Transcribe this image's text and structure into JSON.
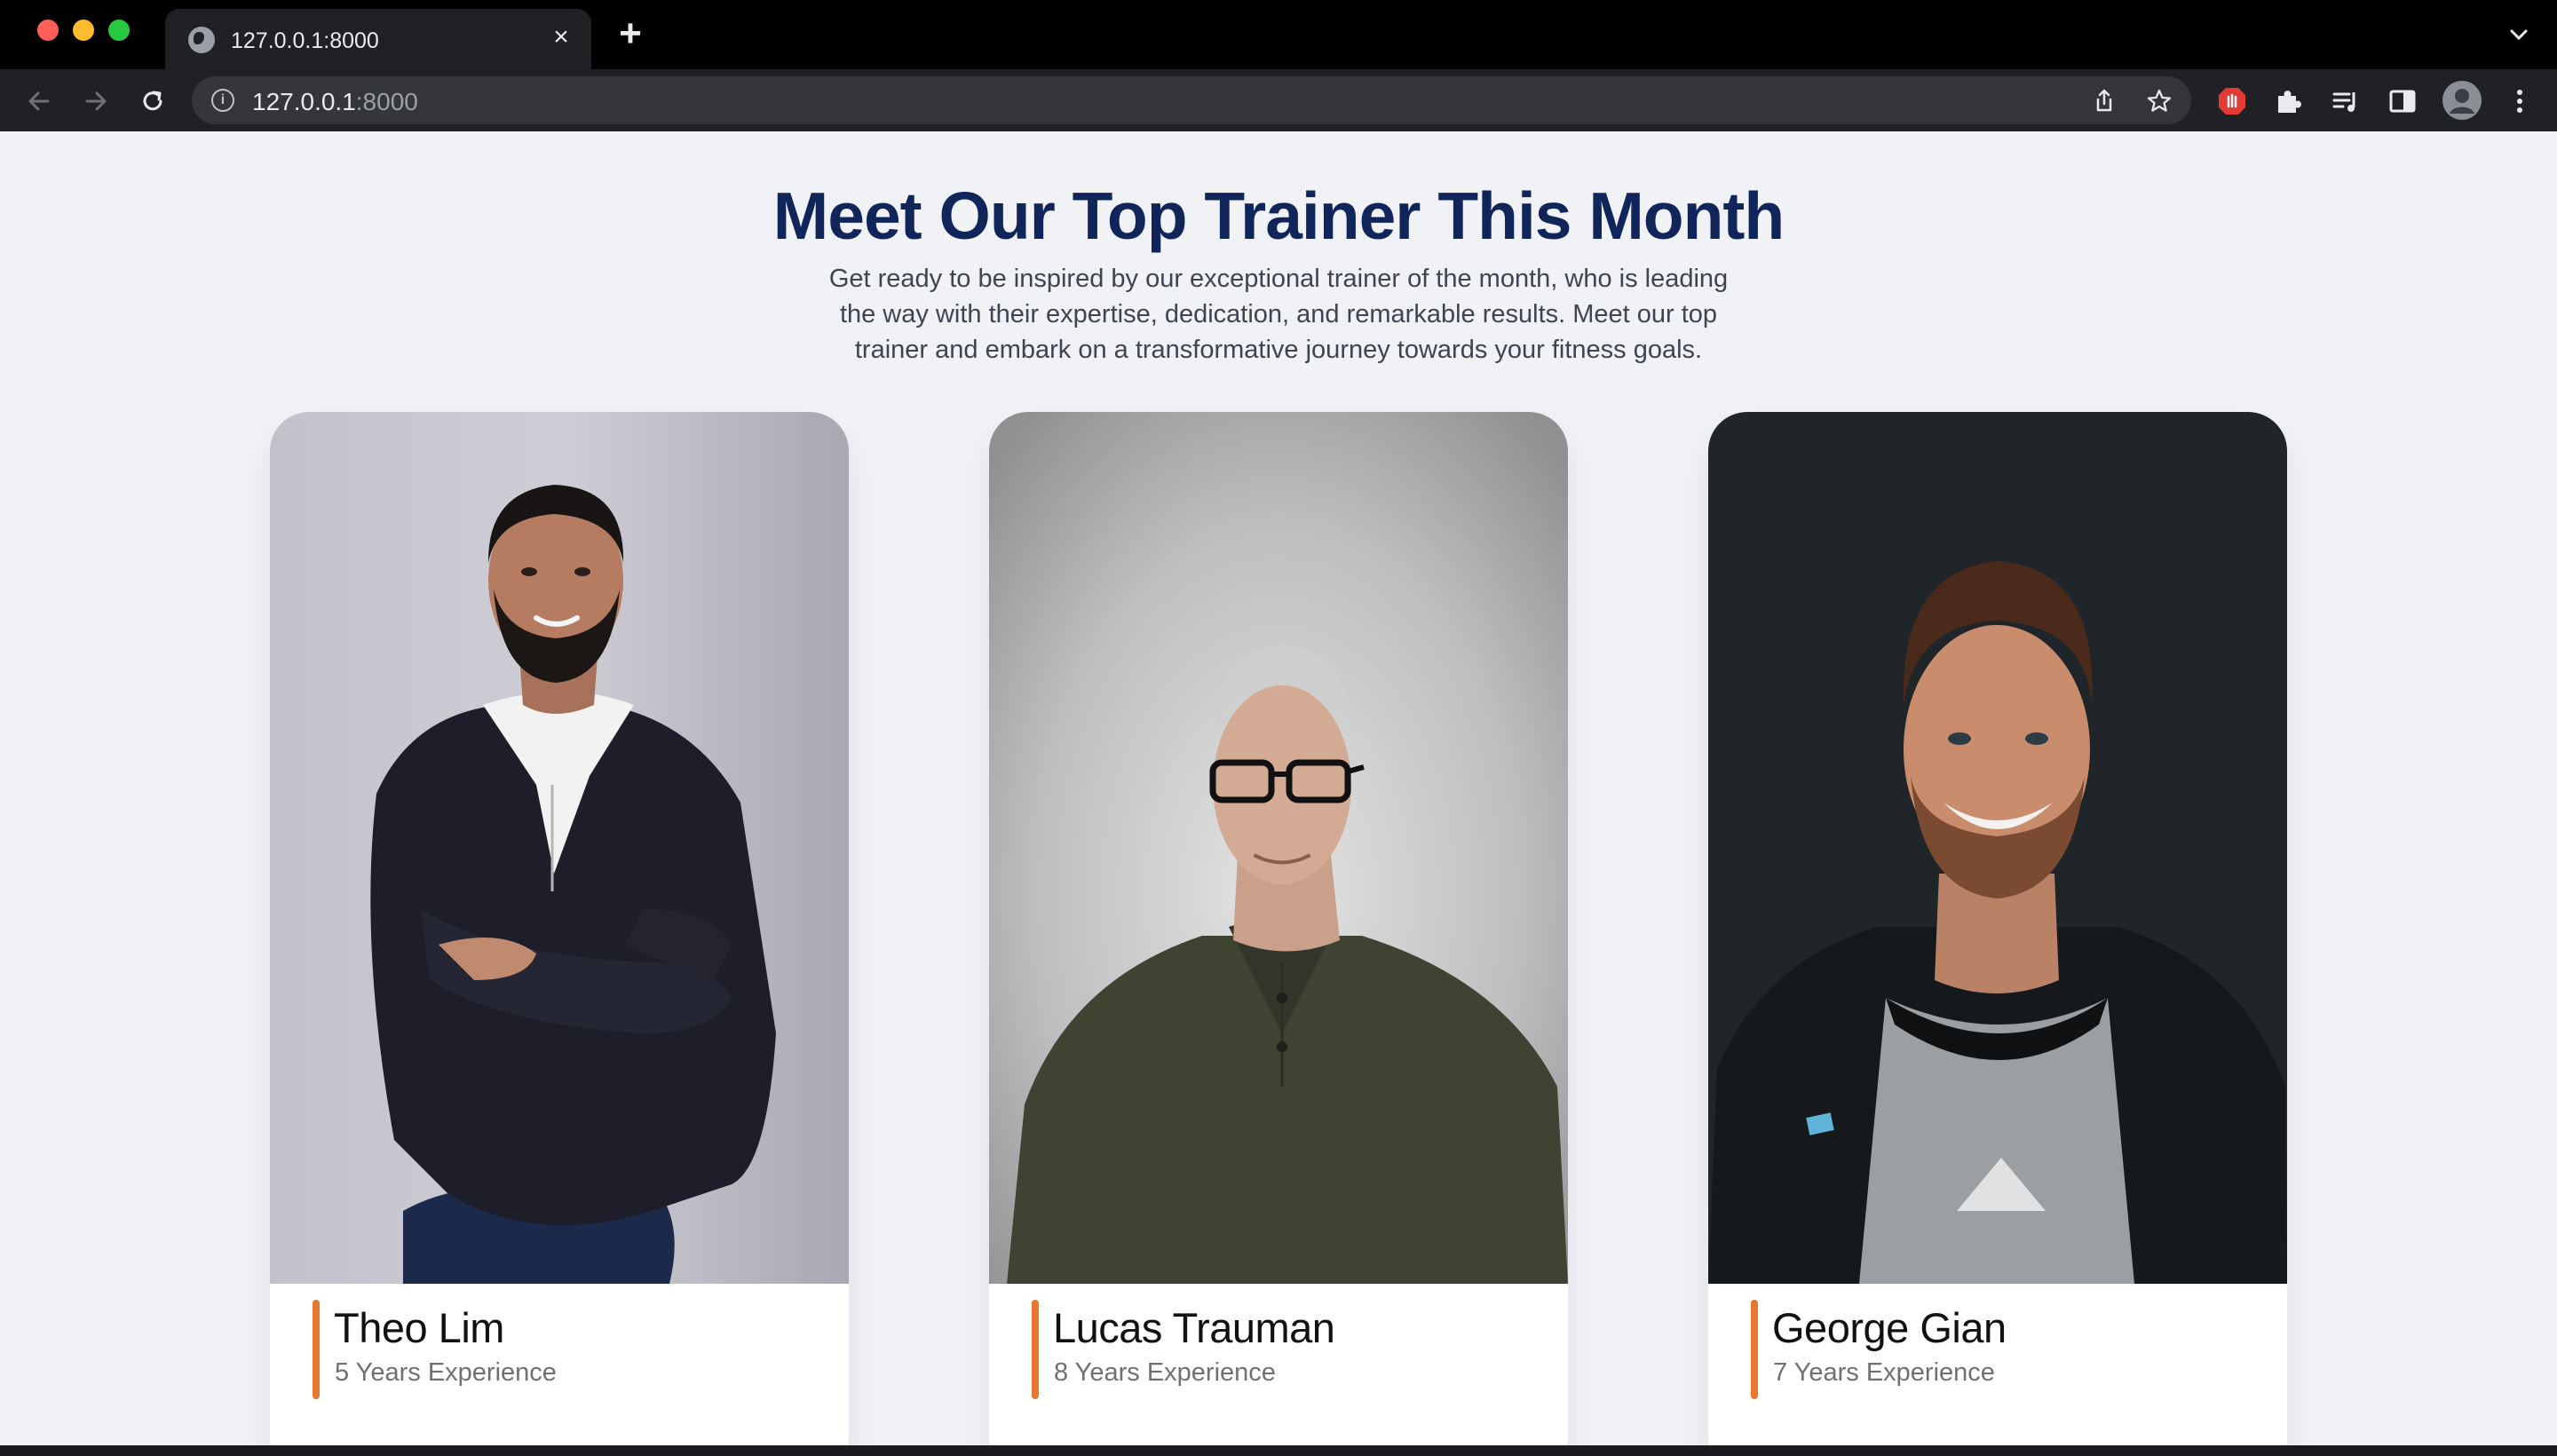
{
  "browser": {
    "tab_title": "127.0.0.1:8000",
    "url_host": "127.0.0.1",
    "url_port": ":8000",
    "colors": {
      "chrome_bg": "#000000",
      "toolbar_bg": "#202124",
      "omnibox_bg": "#35363a"
    }
  },
  "hero": {
    "title": "Meet Our Top Trainer This Month",
    "subtitle": "Get ready to be inspired by our exceptional trainer of the month, who is leading the way with their expertise, dedication, and remarkable results. Meet our top trainer and embark on a transformative journey towards your fitness goals."
  },
  "trainers": [
    {
      "name": "Theo Lim",
      "experience": "5 Years Experience"
    },
    {
      "name": "Lucas Trauman",
      "experience": "8 Years Experience"
    },
    {
      "name": "George Gian",
      "experience": "7 Years Experience"
    }
  ],
  "colors": {
    "heading": "#10255a",
    "accent": "#e8762f",
    "page_bg": "#f1f2f6"
  }
}
